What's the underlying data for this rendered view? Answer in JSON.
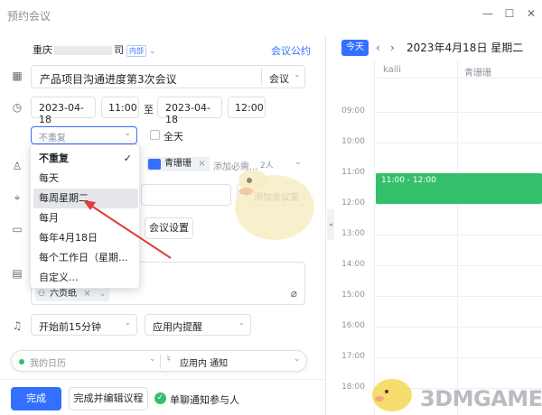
{
  "window": {
    "title": "预约会议",
    "minimize": "—",
    "maximize": "☐",
    "close": "✕"
  },
  "org": {
    "name_prefix": "重庆",
    "name_suffix": "司",
    "badge": "内部"
  },
  "meeting_link": "会议公约",
  "title_input": {
    "value": "产品项目沟通进度第3次会议",
    "type_label": "会议"
  },
  "time": {
    "start_date": "2023-04-18",
    "start_time": "11:00",
    "to": "至",
    "end_date": "2023-04-18",
    "end_time": "12:00"
  },
  "repeat": {
    "value": "不重复",
    "allday_label": "全天"
  },
  "repeat_options": [
    "不重复",
    "每天",
    "每周星期二",
    "每月",
    "每年4月18日",
    "每个工作日（星期...",
    "自定义..."
  ],
  "repeat_selected_index": 0,
  "repeat_hover_index": 2,
  "attendees": {
    "chip": "青珊珊",
    "placeholder": "添加必需...",
    "count": "2人"
  },
  "room": {
    "add_label": "添加会议室"
  },
  "video": {
    "settings_label": "会议设置"
  },
  "desc": {
    "attachment": "六页纸"
  },
  "reminder": {
    "when": "开始前15分钟",
    "type": "应用内提醒"
  },
  "calendar_row": {
    "calendar": "我的日历",
    "notify": "应用内 通知"
  },
  "footer": {
    "done": "完成",
    "done_edit": "完成并编辑议程",
    "notify": "单聊通知参与人"
  },
  "calendar": {
    "today": "今天",
    "title": "2023年4月18日 星期二",
    "columns": [
      "kaili",
      "青珊珊"
    ],
    "hours": [
      "09:00",
      "10:00",
      "11:00",
      "12:00",
      "13:00",
      "14:00",
      "15:00",
      "16:00",
      "17:00",
      "18:00"
    ],
    "event": "11:00 - 12:00",
    "event_color": "#34c06a"
  },
  "watermark": "3DMGAME",
  "accent": "#3370ff"
}
